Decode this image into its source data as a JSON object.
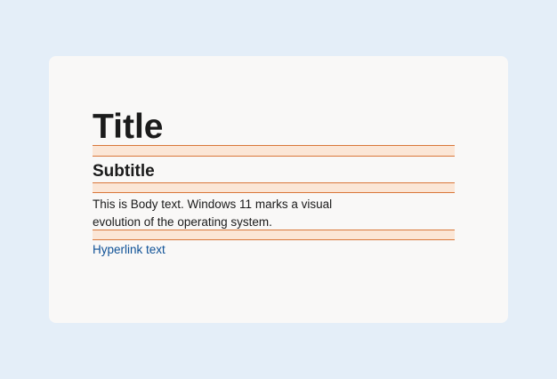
{
  "typography": {
    "title": "Title",
    "subtitle": "Subtitle",
    "body": "This is Body text. Windows 11 marks a visual evolution of the operating system.",
    "hyperlink": "Hyperlink text"
  },
  "colors": {
    "background": "#e4eef8",
    "card": "#f9f8f7",
    "text": "#1b1b1b",
    "link": "#0f5196",
    "spacing_guide_fill": "#fbe6d6",
    "spacing_guide_line": "#d9773a"
  }
}
